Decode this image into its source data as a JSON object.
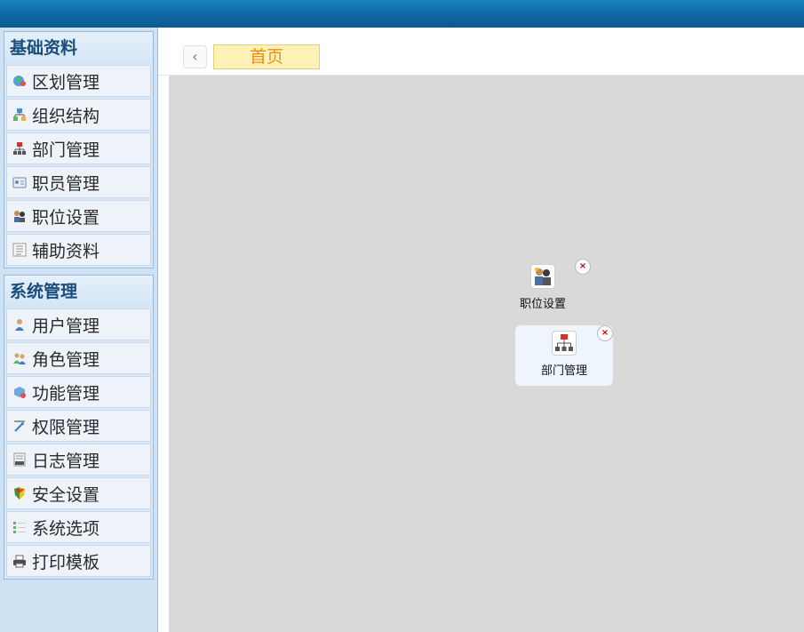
{
  "sidebar": {
    "groups": [
      {
        "title": "基础资料",
        "items": [
          {
            "label": "区划管理",
            "icon": "region-icon"
          },
          {
            "label": "组织结构",
            "icon": "org-structure-icon"
          },
          {
            "label": "部门管理",
            "icon": "department-icon"
          },
          {
            "label": "职员管理",
            "icon": "employee-card-icon"
          },
          {
            "label": "职位设置",
            "icon": "position-icon"
          },
          {
            "label": "辅助资料",
            "icon": "list-icon"
          }
        ]
      },
      {
        "title": "系统管理",
        "items": [
          {
            "label": "用户管理",
            "icon": "user-icon"
          },
          {
            "label": "角色管理",
            "icon": "role-icon"
          },
          {
            "label": "功能管理",
            "icon": "function-icon"
          },
          {
            "label": "权限管理",
            "icon": "permission-icon"
          },
          {
            "label": "日志管理",
            "icon": "log-icon"
          },
          {
            "label": "安全设置",
            "icon": "shield-icon"
          },
          {
            "label": "系统选项",
            "icon": "options-icon"
          },
          {
            "label": "打印模板",
            "icon": "printer-icon"
          }
        ]
      }
    ]
  },
  "tabs": {
    "back_label": "‹",
    "home_label": "首页"
  },
  "desktop": {
    "shortcuts": [
      {
        "label": "职位设置",
        "icon": "position-icon",
        "close": "×"
      },
      {
        "label": "部门管理",
        "icon": "department-icon",
        "close": "×"
      }
    ]
  },
  "colors": {
    "header": "#0f66a3",
    "sidebar_bg": "#cfe2f3",
    "group_title": "#1a4d7a",
    "home_tab_bg": "#fff2b8",
    "home_tab_text": "#f08c12",
    "desktop_bg": "#d9d9d9"
  }
}
